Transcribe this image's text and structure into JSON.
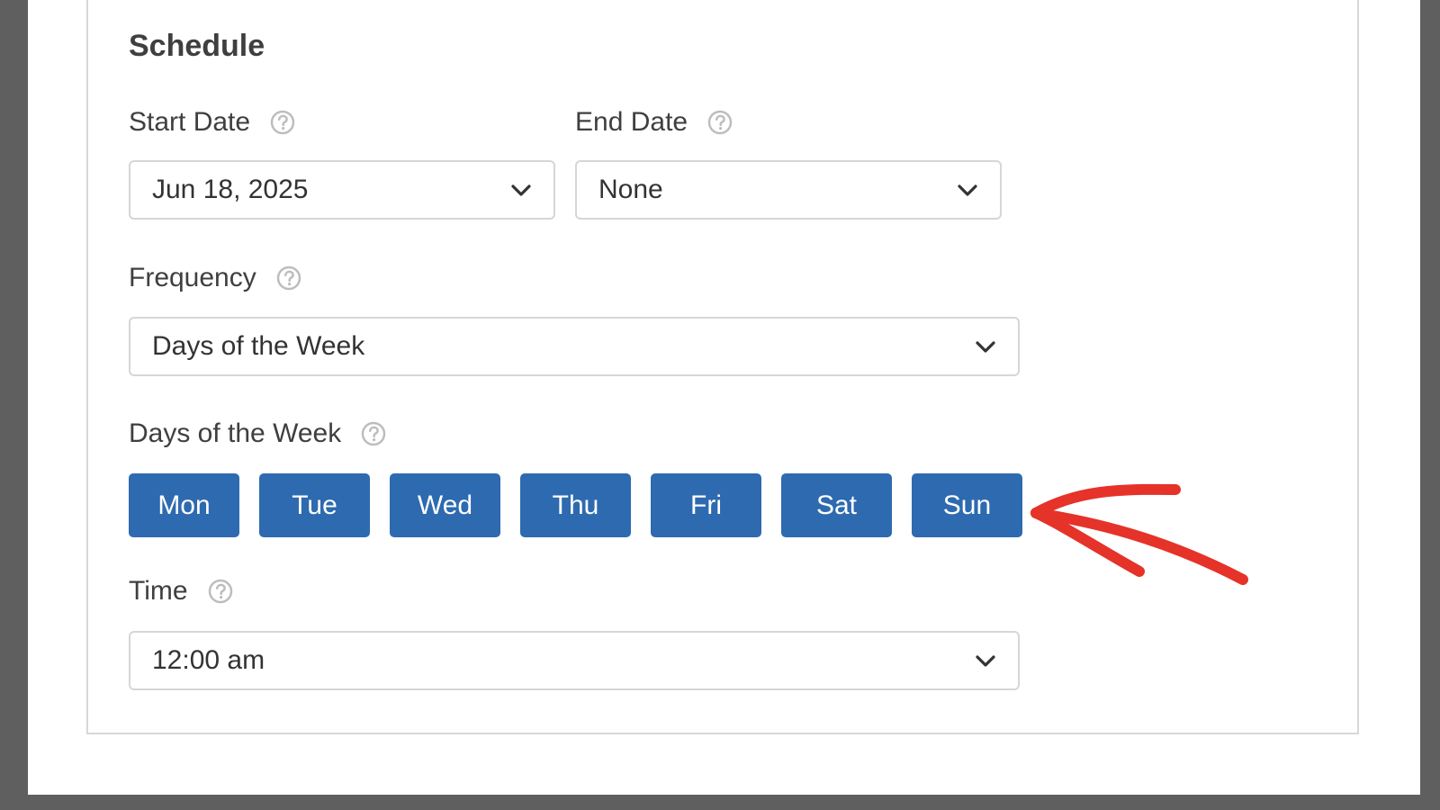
{
  "schedule": {
    "title": "Schedule",
    "start_date": {
      "label": "Start Date",
      "value": "Jun 18, 2025"
    },
    "end_date": {
      "label": "End Date",
      "value": "None"
    },
    "frequency": {
      "label": "Frequency",
      "value": "Days of the Week"
    },
    "days_of_week": {
      "label": "Days of the Week",
      "days": [
        "Mon",
        "Tue",
        "Wed",
        "Thu",
        "Fri",
        "Sat",
        "Sun"
      ]
    },
    "time": {
      "label": "Time",
      "value": "12:00 am"
    }
  },
  "icons": {
    "help": "question-circle-icon",
    "dropdown": "chevron-down-icon",
    "annotation": "red-arrow"
  },
  "colors": {
    "day_button_bg": "#2e6ab0",
    "day_button_text": "#ffffff",
    "annotation_arrow": "#e5332a",
    "page_bg": "#5f5f5f"
  }
}
